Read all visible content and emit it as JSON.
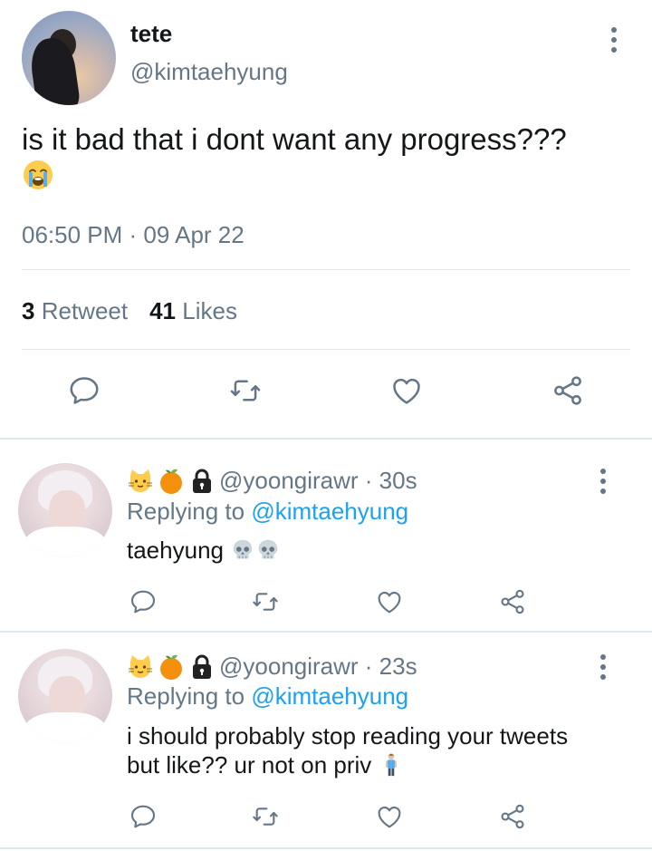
{
  "tweet": {
    "display_name": "tete",
    "handle": "@kimtaehyung",
    "text": "is it bad that i dont want any progress???",
    "emoji": "loudly-crying-face",
    "timestamp": "06:50 PM · 09 Apr 22",
    "retweet_count": "3",
    "retweet_label": "Retweet",
    "likes_count": "41",
    "likes_label": "Likes"
  },
  "actions": [
    "reply-icon",
    "retweet-icon",
    "like-icon",
    "share-icon"
  ],
  "replies": [
    {
      "emojis": [
        "cat-face",
        "tangerine",
        "lock"
      ],
      "handle_time": "@yoongirawr · 30s",
      "replying_prefix": "Replying to",
      "replying_to": "@kimtaehyung",
      "text": "taehyung",
      "trailing_emojis": [
        "skull",
        "skull"
      ]
    },
    {
      "emojis": [
        "cat-face",
        "tangerine",
        "lock"
      ],
      "handle_time": "@yoongirawr · 23s",
      "replying_prefix": "Replying to",
      "replying_to": "@kimtaehyung",
      "text_line1": "i should probably stop reading your tweets",
      "text_line2": "but like?? ur not on priv",
      "trailing_emojis": [
        "man-standing"
      ]
    }
  ],
  "colors": {
    "text": "#14171a",
    "secondary": "#657786",
    "link": "#1da1f2",
    "divider": "#e1e8ed"
  }
}
